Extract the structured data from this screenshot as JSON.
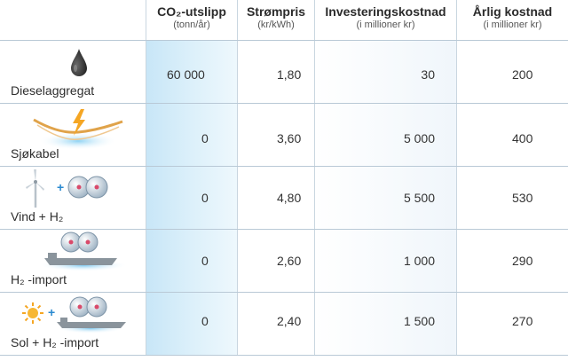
{
  "headers": [
    {
      "title": "CO₂-utslipp",
      "unit": "(tonn/år)"
    },
    {
      "title": "Strømpris",
      "unit": "(kr/kWh)"
    },
    {
      "title": "Investeringskostnad",
      "unit": "(i millioner kr)"
    },
    {
      "title": "Årlig kostnad",
      "unit": "(i millioner kr)"
    }
  ],
  "rows": [
    {
      "label": "Dieselaggregat",
      "icon": "oil-drop-icon",
      "co2": "60 000",
      "price": "1,80",
      "investment": "30",
      "annual": "200"
    },
    {
      "label": "Sjøkabel",
      "icon": "sea-cable-icon",
      "co2": "0",
      "price": "3,60",
      "investment": "5 000",
      "annual": "400"
    },
    {
      "label": "Vind + H₂",
      "icon": "wind-hydrogen-icon",
      "co2": "0",
      "price": "4,80",
      "investment": "5 500",
      "annual": "530"
    },
    {
      "label": "H₂ -import",
      "icon": "hydrogen-ship-icon",
      "co2": "0",
      "price": "2,60",
      "investment": "1 000",
      "annual": "290"
    },
    {
      "label": "Sol + H₂ -import",
      "icon": "sun-hydrogen-ship-icon",
      "co2": "0",
      "price": "2,40",
      "investment": "1 500",
      "annual": "270"
    }
  ],
  "plus_sign": "+"
}
